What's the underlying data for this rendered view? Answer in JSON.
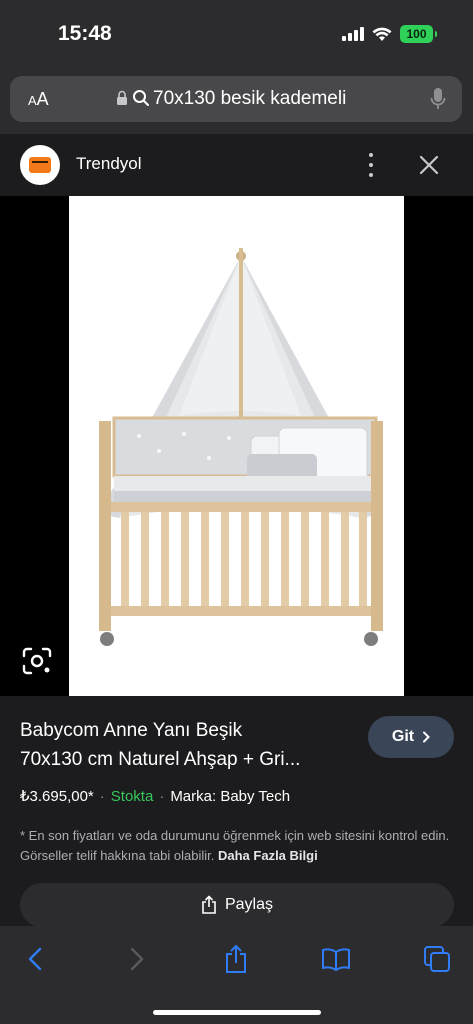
{
  "status_bar": {
    "time": "15:48",
    "battery": "100",
    "icons": [
      "signal-icon",
      "wifi-icon",
      "battery-icon"
    ]
  },
  "address_bar": {
    "text_size_label_small": "A",
    "text_size_label_large": "A",
    "url_text": "70x130 besik kademeli",
    "icons": [
      "lock-icon",
      "search-icon",
      "microphone-icon"
    ]
  },
  "header": {
    "site_name": "Trendyol",
    "icons": [
      "trendyol-logo",
      "more-options-icon",
      "close-icon"
    ]
  },
  "image": {
    "description_icon": "visual-search-icon"
  },
  "product": {
    "title_line1": "Babycom Anne Yanı Beşik",
    "title_line2": "70x130 cm Naturel Ahşap + Gri...",
    "goto_label": "Git",
    "price": "₺3.695,00*",
    "separator": "·",
    "stock": "Stokta",
    "brand": "Marka: Baby Tech",
    "disclaimer": "* En son fiyatları ve oda durumunu öğrenmek için web sitesini kontrol edin. Görseller telif hakkına tabi olabilir.",
    "more_info_label": "Daha Fazla Bilgi",
    "share_label": "Paylaş"
  },
  "toolbar": {
    "icons": [
      "back-icon",
      "forward-icon",
      "share-icon",
      "bookmarks-icon",
      "tabs-icon"
    ]
  },
  "colors": {
    "accent": "#2f7cf6",
    "stock_green": "#35c759",
    "battery_green": "#2fd158",
    "brand_orange": "#f27a1a"
  }
}
